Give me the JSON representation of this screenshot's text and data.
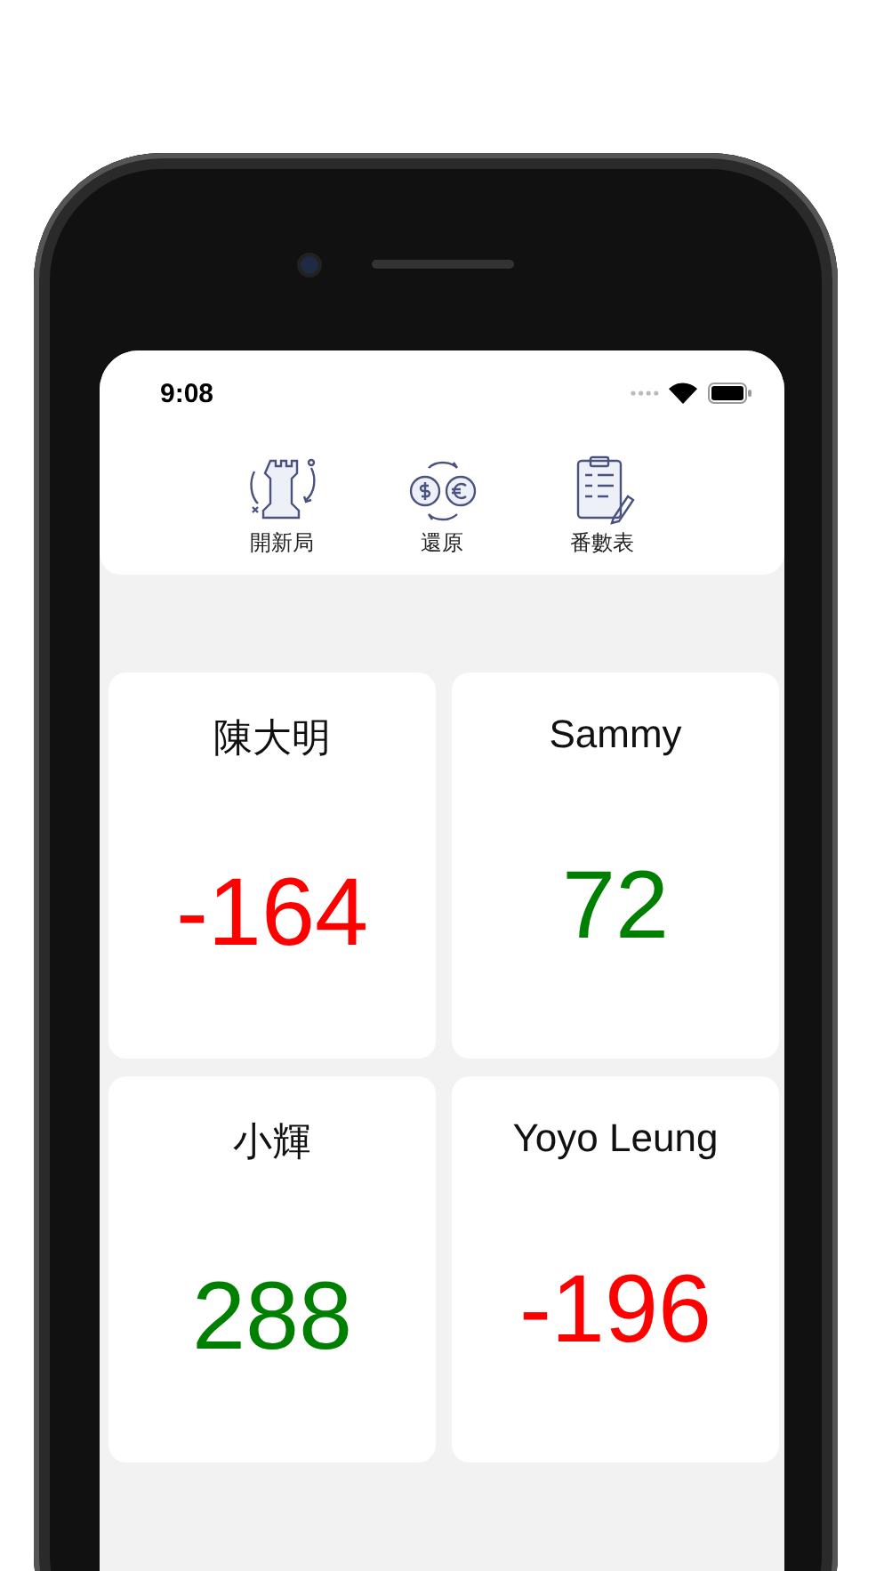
{
  "status_bar": {
    "time": "9:08"
  },
  "toolbar": [
    {
      "kind": "chess",
      "label": "開新局"
    },
    {
      "kind": "exchange",
      "label": "還原"
    },
    {
      "kind": "clipboard",
      "label": "番數表"
    }
  ],
  "players": [
    {
      "name": "陳大明",
      "score": "-164",
      "color": "#ff0000"
    },
    {
      "name": "Sammy",
      "score": "72",
      "color": "#008000"
    },
    {
      "name": "小輝",
      "score": "288",
      "color": "#008000"
    },
    {
      "name": "Yoyo Leung",
      "score": "-196",
      "color": "#ff0000"
    }
  ]
}
